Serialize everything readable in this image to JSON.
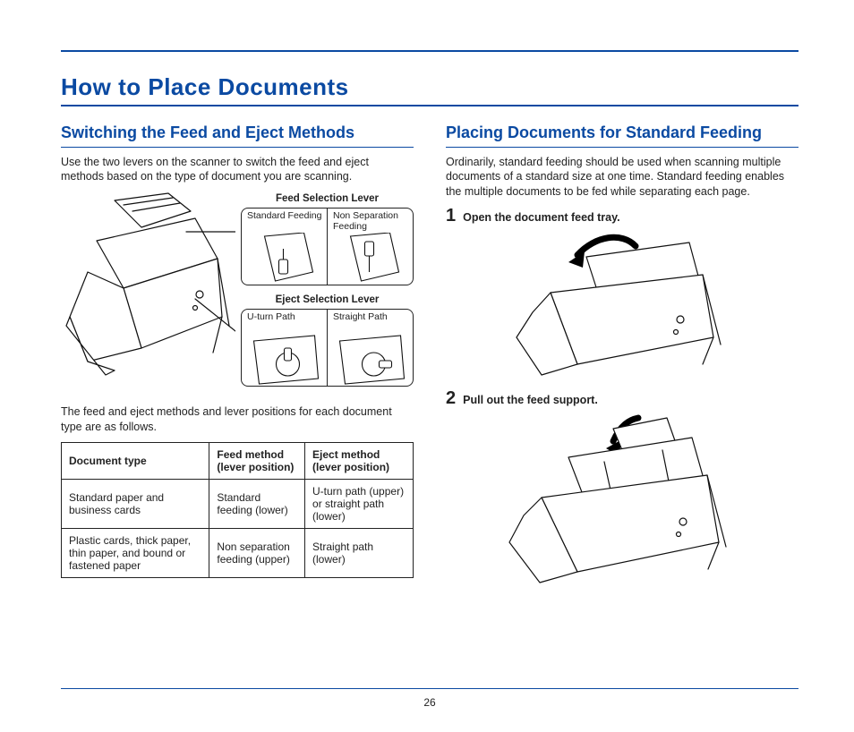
{
  "page_number": "26",
  "title": "How to Place Documents",
  "left": {
    "heading": "Switching the Feed and Eject Methods",
    "intro": "Use the two levers on the scanner to switch the feed and eject methods based on the type of document you are scanning.",
    "feed_lever_title": "Feed Selection Lever",
    "feed_cells": [
      "Standard Feeding",
      "Non Separation Feeding"
    ],
    "eject_lever_title": "Eject Selection Lever",
    "eject_cells": [
      "U-turn Path",
      "Straight Path"
    ],
    "para2": "The feed and eject methods and lever positions for each document type are as follows.",
    "table": {
      "headers": [
        "Document type",
        "Feed method (lever position)",
        "Eject method (lever position)"
      ],
      "rows": [
        [
          "Standard paper and business cards",
          "Standard feeding (lower)",
          "U-turn path (upper) or straight path (lower)"
        ],
        [
          "Plastic cards, thick paper, thin paper, and bound or fastened paper",
          "Non separation feeding (upper)",
          "Straight path (lower)"
        ]
      ]
    }
  },
  "right": {
    "heading": "Placing Documents for Standard Feeding",
    "intro": "Ordinarily, standard feeding should be used when scanning multiple documents of a standard size at one time. Standard feeding enables the multiple documents to be fed while separating each page.",
    "steps": [
      {
        "num": "1",
        "text": "Open the document feed tray."
      },
      {
        "num": "2",
        "text": "Pull out the feed support."
      }
    ]
  }
}
